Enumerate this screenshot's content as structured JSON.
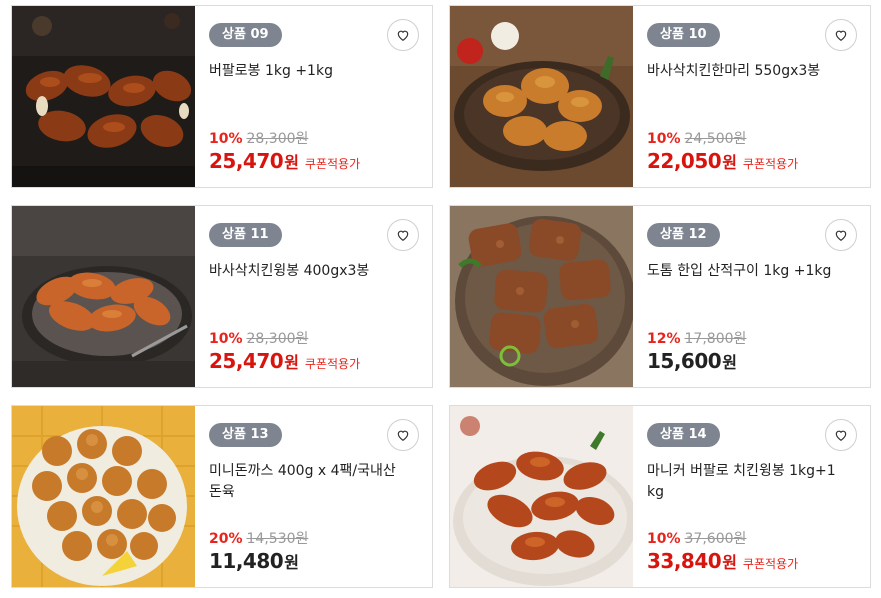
{
  "products": [
    {
      "badge": "상품 09",
      "name": "버팔로봉 1kg +1kg",
      "rate": "10%",
      "original_price": "28,300원",
      "final_price": "25,470",
      "currency": "원",
      "coupon": "쿠폰적용가",
      "price_color": "#d8140e",
      "image": "buffalo-wings-on-slate"
    },
    {
      "badge": "상품 10",
      "name": "바사삭치킨한마리 550gx3봉",
      "rate": "10%",
      "original_price": "24,500원",
      "final_price": "22,050",
      "currency": "원",
      "coupon": "쿠폰적용가",
      "price_color": "#d8140e",
      "image": "fried-chicken-plate"
    },
    {
      "badge": "상품 11",
      "name": "바사삭치킨윙봉 400gx3봉",
      "rate": "10%",
      "original_price": "28,300원",
      "final_price": "25,470",
      "currency": "원",
      "coupon": "쿠폰적용가",
      "price_color": "#d8140e",
      "image": "crispy-wings-plate"
    },
    {
      "badge": "상품 12",
      "name": "도톰 한입 산적구이 1kg +1kg",
      "rate": "12%",
      "original_price": "17,800원",
      "final_price": "15,600",
      "currency": "원",
      "coupon": "",
      "price_color": "#222222",
      "image": "grilled-meat-patties"
    },
    {
      "badge": "상품 13",
      "name": "미니돈까스 400g x 4팩/국내산 돈육",
      "rate": "20%",
      "original_price": "14,530원",
      "final_price": "11,480",
      "currency": "원",
      "coupon": "",
      "price_color": "#222222",
      "image": "mini-pork-cutlet-balls"
    },
    {
      "badge": "상품 14",
      "name": "마니커 버팔로 치킨윙봉 1kg+1kg",
      "rate": "10%",
      "original_price": "37,600원",
      "final_price": "33,840",
      "currency": "원",
      "coupon": "쿠폰적용가",
      "price_color": "#d8140e",
      "image": "buffalo-chicken-wings-plate"
    }
  ],
  "icons": {
    "wishlist": "heart-icon"
  },
  "colors": {
    "discount_red": "#e8251c",
    "badge_gray": "#7e8590",
    "border": "#dcdcdc"
  }
}
